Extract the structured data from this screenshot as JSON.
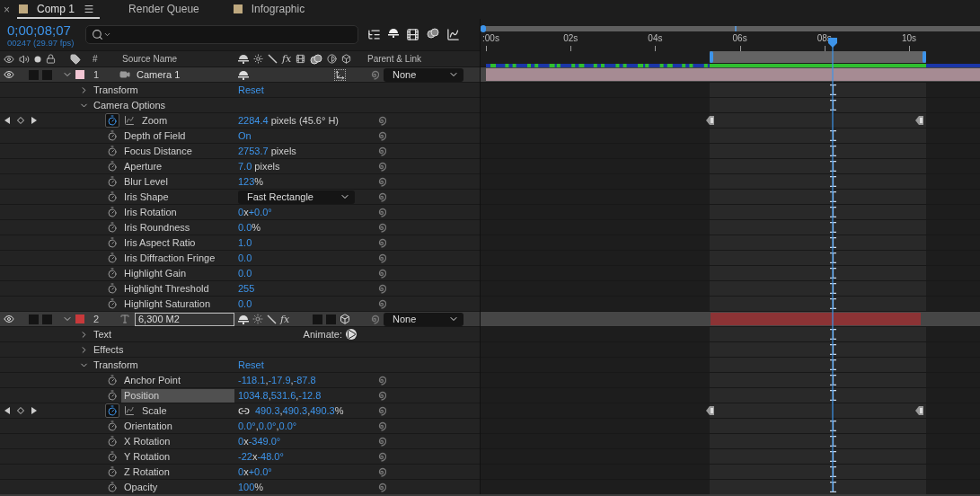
{
  "close": "×",
  "tabs": [
    {
      "label": "Comp 1",
      "selected": true,
      "color": "#bfa97f"
    },
    {
      "label": "Render Queue",
      "selected": false
    },
    {
      "label": "Infographic",
      "selected": false,
      "color": "#bfa97f"
    }
  ],
  "timecode": "0;00;08;07",
  "frame_info": "00247 (29.97 fps)",
  "headers": {
    "number": "#",
    "source_name": "Source Name",
    "fx": "fx",
    "parent": "Parent & Link"
  },
  "ruler": [
    ":00s",
    "02s",
    "04s",
    "06s",
    "08s",
    "10s"
  ],
  "layers": [
    {
      "number": "1",
      "name": "Camera 1",
      "kind": "camera",
      "color": "#f2c6d4",
      "expanded": true,
      "editing": false,
      "parent": "None",
      "children": [
        {
          "name": "Transform",
          "expanded": false,
          "value": "Reset"
        },
        {
          "name": "Camera Options",
          "expanded": true,
          "children": [
            {
              "name": "Zoom",
              "kind": "value",
              "animated": true,
              "selected": false,
              "value": [
                "2284.4",
                " pixels (45.6° H)"
              ]
            },
            {
              "name": "Depth of Field",
              "kind": "value",
              "animated": false,
              "selected": false,
              "value": [
                "On"
              ]
            },
            {
              "name": "Focus Distance",
              "kind": "value",
              "animated": false,
              "selected": false,
              "value": [
                "2753.7",
                " pixels"
              ]
            },
            {
              "name": "Aperture",
              "kind": "value",
              "animated": false,
              "selected": false,
              "value": [
                "7.0",
                " pixels"
              ]
            },
            {
              "name": "Blur Level",
              "kind": "value",
              "animated": false,
              "selected": false,
              "value": [
                "123",
                "%"
              ]
            },
            {
              "name": "Iris Shape",
              "kind": "dropdown",
              "animated": false,
              "selected": false,
              "value": [
                "Fast Rectangle"
              ]
            },
            {
              "name": "Iris Rotation",
              "kind": "value",
              "animated": false,
              "selected": false,
              "value": [
                "0",
                "x",
                "+0.0°"
              ]
            },
            {
              "name": "Iris Roundness",
              "kind": "value",
              "animated": false,
              "selected": false,
              "value": [
                "0.0",
                "%"
              ]
            },
            {
              "name": "Iris Aspect Ratio",
              "kind": "value",
              "animated": false,
              "selected": false,
              "value": [
                "1.0"
              ]
            },
            {
              "name": "Iris Diffraction Fringe",
              "kind": "value",
              "animated": false,
              "selected": false,
              "value": [
                "0.0"
              ]
            },
            {
              "name": "Highlight Gain",
              "kind": "value",
              "animated": false,
              "selected": false,
              "value": [
                "0.0"
              ]
            },
            {
              "name": "Highlight Threshold",
              "kind": "value",
              "animated": false,
              "selected": false,
              "value": [
                "255"
              ]
            },
            {
              "name": "Highlight Saturation",
              "kind": "value",
              "animated": false,
              "selected": false,
              "value": [
                "0.0"
              ]
            }
          ]
        }
      ]
    },
    {
      "number": "2",
      "name": "6,300 M2",
      "kind": "text",
      "color": "#c8393b",
      "expanded": true,
      "editing": true,
      "parent": "None",
      "fx": "fx",
      "children": [
        {
          "name": "Text",
          "expanded": false,
          "action": "Animate:"
        },
        {
          "name": "Effects",
          "expanded": false
        },
        {
          "name": "Transform",
          "expanded": true,
          "value": "Reset",
          "children": [
            {
              "name": "Anchor Point",
              "kind": "value",
              "animated": false,
              "selected": false,
              "value": [
                "-118.1",
                ",",
                "-17.9",
                ",",
                "-87.8"
              ]
            },
            {
              "name": "Position",
              "kind": "value",
              "animated": false,
              "selected": true,
              "value": [
                "1034.8",
                ",",
                "531.6",
                ",",
                "-12.8"
              ]
            },
            {
              "name": "Scale",
              "kind": "linked_value",
              "animated": true,
              "selected": false,
              "value": [
                "490.3",
                ",",
                "490.3",
                ",",
                "490.3",
                "%"
              ]
            },
            {
              "name": "Orientation",
              "kind": "value",
              "animated": false,
              "selected": false,
              "value": [
                "0.0°",
                ",",
                "0.0°",
                ",",
                "0.0°"
              ]
            },
            {
              "name": "X Rotation",
              "kind": "value",
              "animated": false,
              "selected": false,
              "value": [
                "0",
                "x",
                "-349.0°"
              ]
            },
            {
              "name": "Y Rotation",
              "kind": "value",
              "animated": false,
              "selected": false,
              "value": [
                "-22",
                "x",
                "-48.0°"
              ]
            },
            {
              "name": "Z Rotation",
              "kind": "value",
              "animated": false,
              "selected": false,
              "value": [
                "0",
                "x",
                "+0.0°"
              ]
            },
            {
              "name": "Opacity",
              "kind": "value",
              "animated": false,
              "selected": false,
              "value": [
                "100",
                "%"
              ]
            }
          ]
        }
      ]
    }
  ]
}
